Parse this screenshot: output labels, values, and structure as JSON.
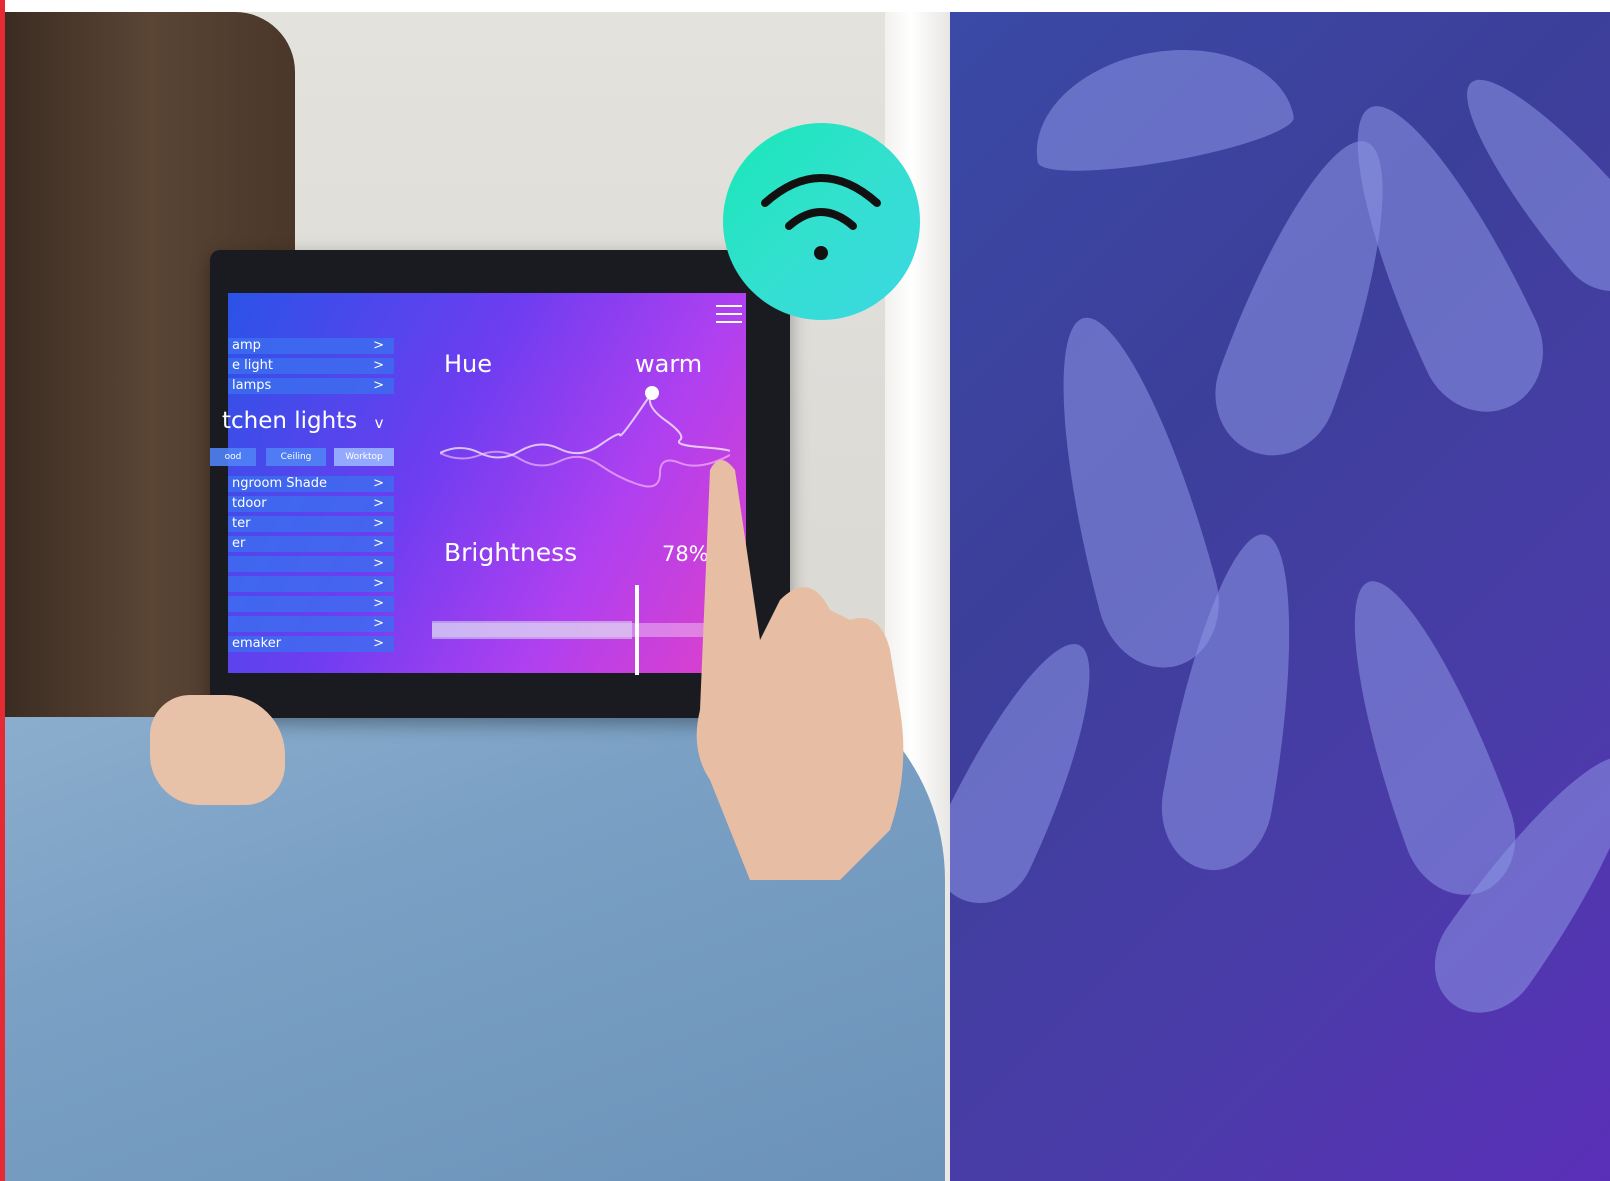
{
  "tablet_ui": {
    "list_top": [
      {
        "label": "amp",
        "chevron": ">"
      },
      {
        "label": "e light",
        "chevron": ">"
      },
      {
        "label": "lamps",
        "chevron": ">"
      }
    ],
    "section_title": "tchen lights",
    "section_caret": "v",
    "tabs": [
      "ood",
      "Ceiling",
      "Worktop"
    ],
    "list_bottom": [
      {
        "label": "ngroom Shade",
        "chevron": ">"
      },
      {
        "label": "tdoor",
        "chevron": ">"
      },
      {
        "label": "ter",
        "chevron": ">"
      },
      {
        "label": "er",
        "chevron": ">"
      },
      {
        "label": "",
        "chevron": ">"
      },
      {
        "label": "",
        "chevron": ">"
      },
      {
        "label": "",
        "chevron": ">"
      },
      {
        "label": "",
        "chevron": ">"
      },
      {
        "label": "emaker",
        "chevron": ">"
      }
    ],
    "hue": {
      "label": "Hue",
      "value": "warm"
    },
    "brightness": {
      "label": "Brightness",
      "value": "78%"
    }
  },
  "icons": {
    "menu": "hamburger-menu-icon",
    "wifi": "wifi-icon"
  },
  "colors": {
    "wifi_badge": "#2fe3c8",
    "screen_gradient_start": "#2a53e6",
    "screen_gradient_end": "#e040c8",
    "plant_overlay": "#4a3ca8",
    "left_edge": "#e52a33"
  }
}
